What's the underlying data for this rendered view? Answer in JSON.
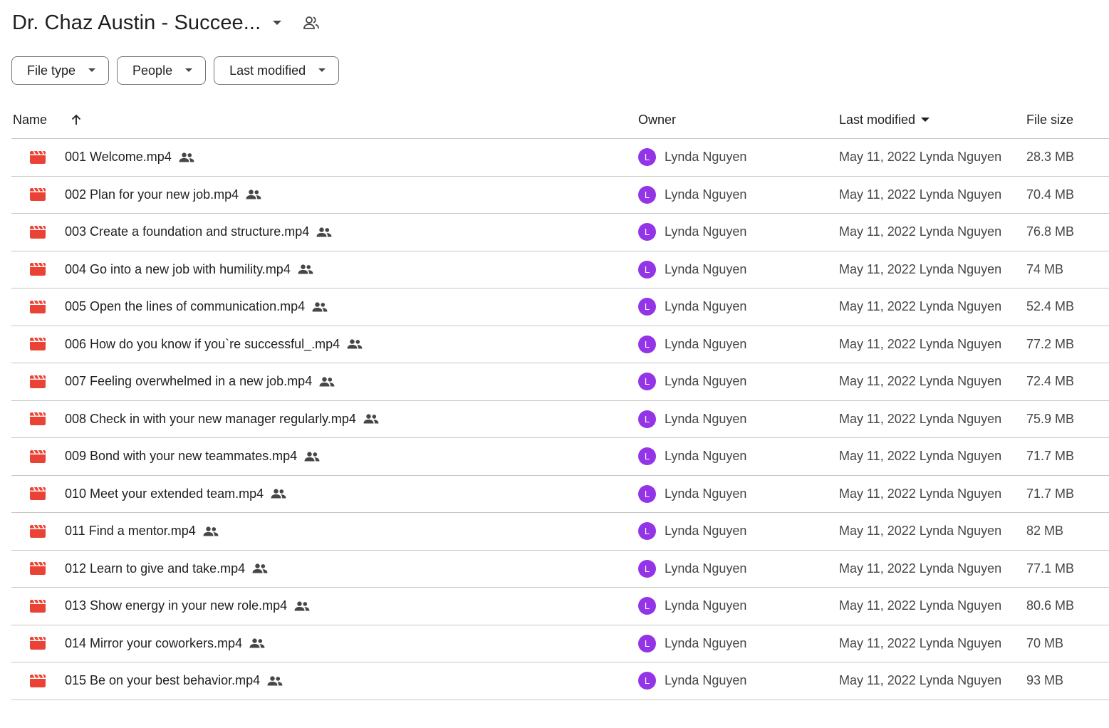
{
  "header": {
    "title": "Dr. Chaz Austin - Succee..."
  },
  "filters": [
    {
      "label": "File type"
    },
    {
      "label": "People"
    },
    {
      "label": "Last modified"
    }
  ],
  "columns": {
    "name": "Name",
    "owner": "Owner",
    "last_modified": "Last modified",
    "file_size": "File size"
  },
  "icons": {
    "file": "video-file-icon",
    "shared": "people-icon",
    "sort": "arrow-up-icon"
  },
  "colors": {
    "video_icon": "#ea4335",
    "avatar": "#9334e6"
  },
  "files": [
    {
      "name": "001 Welcome.mp4",
      "owner_initial": "L",
      "owner": "Lynda Nguyen",
      "modified": "May 11, 2022 Lynda Nguyen",
      "size": "28.3 MB"
    },
    {
      "name": "002 Plan for your new job.mp4",
      "owner_initial": "L",
      "owner": "Lynda Nguyen",
      "modified": "May 11, 2022 Lynda Nguyen",
      "size": "70.4 MB"
    },
    {
      "name": "003 Create a foundation and structure.mp4",
      "owner_initial": "L",
      "owner": "Lynda Nguyen",
      "modified": "May 11, 2022 Lynda Nguyen",
      "size": "76.8 MB"
    },
    {
      "name": "004 Go into a new job with humility.mp4",
      "owner_initial": "L",
      "owner": "Lynda Nguyen",
      "modified": "May 11, 2022 Lynda Nguyen",
      "size": "74 MB"
    },
    {
      "name": "005 Open the lines of communication.mp4",
      "owner_initial": "L",
      "owner": "Lynda Nguyen",
      "modified": "May 11, 2022 Lynda Nguyen",
      "size": "52.4 MB"
    },
    {
      "name": "006 How do you know if you`re successful_.mp4",
      "owner_initial": "L",
      "owner": "Lynda Nguyen",
      "modified": "May 11, 2022 Lynda Nguyen",
      "size": "77.2 MB"
    },
    {
      "name": "007 Feeling overwhelmed in a new job.mp4",
      "owner_initial": "L",
      "owner": "Lynda Nguyen",
      "modified": "May 11, 2022 Lynda Nguyen",
      "size": "72.4 MB"
    },
    {
      "name": "008 Check in with your new manager regularly.mp4",
      "owner_initial": "L",
      "owner": "Lynda Nguyen",
      "modified": "May 11, 2022 Lynda Nguyen",
      "size": "75.9 MB"
    },
    {
      "name": "009 Bond with your new teammates.mp4",
      "owner_initial": "L",
      "owner": "Lynda Nguyen",
      "modified": "May 11, 2022 Lynda Nguyen",
      "size": "71.7 MB"
    },
    {
      "name": "010 Meet your extended team.mp4",
      "owner_initial": "L",
      "owner": "Lynda Nguyen",
      "modified": "May 11, 2022 Lynda Nguyen",
      "size": "71.7 MB"
    },
    {
      "name": "011 Find a mentor.mp4",
      "owner_initial": "L",
      "owner": "Lynda Nguyen",
      "modified": "May 11, 2022 Lynda Nguyen",
      "size": "82 MB"
    },
    {
      "name": "012 Learn to give and take.mp4",
      "owner_initial": "L",
      "owner": "Lynda Nguyen",
      "modified": "May 11, 2022 Lynda Nguyen",
      "size": "77.1 MB"
    },
    {
      "name": "013 Show energy in your new role.mp4",
      "owner_initial": "L",
      "owner": "Lynda Nguyen",
      "modified": "May 11, 2022 Lynda Nguyen",
      "size": "80.6 MB"
    },
    {
      "name": "014 Mirror your coworkers.mp4",
      "owner_initial": "L",
      "owner": "Lynda Nguyen",
      "modified": "May 11, 2022 Lynda Nguyen",
      "size": "70 MB"
    },
    {
      "name": "015 Be on your best behavior.mp4",
      "owner_initial": "L",
      "owner": "Lynda Nguyen",
      "modified": "May 11, 2022 Lynda Nguyen",
      "size": "93 MB"
    }
  ]
}
